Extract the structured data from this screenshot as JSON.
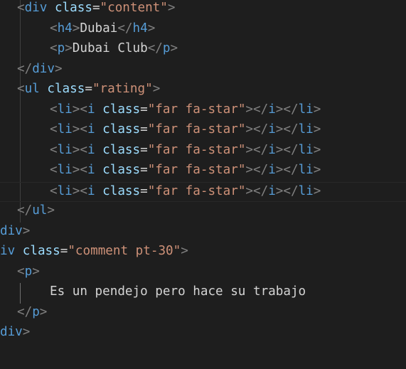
{
  "editor": {
    "colors": {
      "background": "#1e1e1e",
      "punctuation": "#808080",
      "tag": "#569cd6",
      "attribute": "#9cdcfe",
      "string": "#ce9178",
      "text": "#d4d4d4"
    },
    "lines": [
      [
        [
          "p",
          "<"
        ],
        [
          "tag",
          "div"
        ],
        [
          "t",
          " "
        ],
        [
          "attr",
          "class"
        ],
        [
          "eq",
          "="
        ],
        [
          "str",
          "\"content\""
        ],
        [
          "p",
          ">"
        ]
      ],
      [
        [
          "p",
          "<"
        ],
        [
          "tag",
          "h4"
        ],
        [
          "p",
          ">"
        ],
        [
          "t",
          "Dubai"
        ],
        [
          "p",
          "</"
        ],
        [
          "tag",
          "h4"
        ],
        [
          "p",
          ">"
        ]
      ],
      [
        [
          "p",
          "<"
        ],
        [
          "tag",
          "p"
        ],
        [
          "p",
          ">"
        ],
        [
          "t",
          "Dubai Club"
        ],
        [
          "p",
          "</"
        ],
        [
          "tag",
          "p"
        ],
        [
          "p",
          ">"
        ]
      ],
      [
        [
          "p",
          "</"
        ],
        [
          "tag",
          "div"
        ],
        [
          "p",
          ">"
        ]
      ],
      [
        [
          "p",
          "<"
        ],
        [
          "tag",
          "ul"
        ],
        [
          "t",
          " "
        ],
        [
          "attr",
          "class"
        ],
        [
          "eq",
          "="
        ],
        [
          "str",
          "\"rating\""
        ],
        [
          "p",
          ">"
        ]
      ],
      [
        [
          "p",
          "<"
        ],
        [
          "tag",
          "li"
        ],
        [
          "p",
          "><"
        ],
        [
          "tag",
          "i"
        ],
        [
          "t",
          " "
        ],
        [
          "attr",
          "class"
        ],
        [
          "eq",
          "="
        ],
        [
          "str",
          "\"far fa-star\""
        ],
        [
          "p",
          "></"
        ],
        [
          "tag",
          "i"
        ],
        [
          "p",
          "></"
        ],
        [
          "tag",
          "li"
        ],
        [
          "p",
          ">"
        ]
      ],
      [
        [
          "p",
          "<"
        ],
        [
          "tag",
          "li"
        ],
        [
          "p",
          "><"
        ],
        [
          "tag",
          "i"
        ],
        [
          "t",
          " "
        ],
        [
          "attr",
          "class"
        ],
        [
          "eq",
          "="
        ],
        [
          "str",
          "\"far fa-star\""
        ],
        [
          "p",
          "></"
        ],
        [
          "tag",
          "i"
        ],
        [
          "p",
          "></"
        ],
        [
          "tag",
          "li"
        ],
        [
          "p",
          ">"
        ]
      ],
      [
        [
          "p",
          "<"
        ],
        [
          "tag",
          "li"
        ],
        [
          "p",
          "><"
        ],
        [
          "tag",
          "i"
        ],
        [
          "t",
          " "
        ],
        [
          "attr",
          "class"
        ],
        [
          "eq",
          "="
        ],
        [
          "str",
          "\"far fa-star\""
        ],
        [
          "p",
          "></"
        ],
        [
          "tag",
          "i"
        ],
        [
          "p",
          "></"
        ],
        [
          "tag",
          "li"
        ],
        [
          "p",
          ">"
        ]
      ],
      [
        [
          "p",
          "<"
        ],
        [
          "tag",
          "li"
        ],
        [
          "p",
          "><"
        ],
        [
          "tag",
          "i"
        ],
        [
          "t",
          " "
        ],
        [
          "attr",
          "class"
        ],
        [
          "eq",
          "="
        ],
        [
          "str",
          "\"far fa-star\""
        ],
        [
          "p",
          "></"
        ],
        [
          "tag",
          "i"
        ],
        [
          "p",
          "></"
        ],
        [
          "tag",
          "li"
        ],
        [
          "p",
          ">"
        ]
      ],
      [
        [
          "p",
          "<"
        ],
        [
          "tag",
          "li"
        ],
        [
          "p",
          "><"
        ],
        [
          "tag",
          "i"
        ],
        [
          "t",
          " "
        ],
        [
          "attr",
          "class"
        ],
        [
          "eq",
          "="
        ],
        [
          "str",
          "\"far fa-star\""
        ],
        [
          "p",
          "></"
        ],
        [
          "tag",
          "i"
        ],
        [
          "p",
          "></"
        ],
        [
          "tag",
          "li"
        ],
        [
          "p",
          ">"
        ]
      ],
      [
        [
          "p",
          "</"
        ],
        [
          "tag",
          "ul"
        ],
        [
          "p",
          ">"
        ]
      ],
      [
        [
          "tag",
          "div"
        ],
        [
          "p",
          ">"
        ]
      ],
      [
        [
          "tag",
          "iv"
        ],
        [
          "t",
          " "
        ],
        [
          "attr",
          "class"
        ],
        [
          "eq",
          "="
        ],
        [
          "str",
          "\"comment pt-30\""
        ],
        [
          "p",
          ">"
        ]
      ],
      [
        [
          "p",
          "<"
        ],
        [
          "tag",
          "p"
        ],
        [
          "p",
          ">"
        ]
      ],
      [
        [
          "t",
          "Es un pendejo pero hace su trabajo"
        ]
      ],
      [
        [
          "p",
          "</"
        ],
        [
          "tag",
          "p"
        ],
        [
          "p",
          ">"
        ]
      ],
      [
        [
          "tag",
          "div"
        ],
        [
          "p",
          ">"
        ]
      ]
    ]
  }
}
